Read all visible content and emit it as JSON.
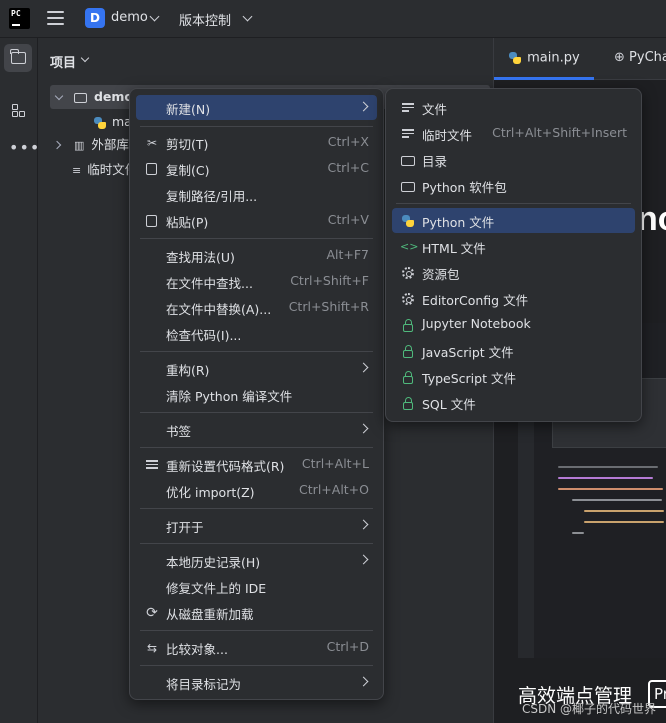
{
  "app": {
    "logo_text": "PC",
    "project_badge": "D",
    "project_name": "demo",
    "vcs_label": "版本控制"
  },
  "project_panel": {
    "title": "项目",
    "tree": [
      {
        "label": "demo",
        "type": "folder"
      },
      {
        "label": "main.py",
        "type": "python-file"
      },
      {
        "label": "外部库",
        "type": "library"
      },
      {
        "label": "临时文件和控制台",
        "type": "scratch"
      }
    ]
  },
  "editor": {
    "tabs": [
      {
        "label": "main.py"
      },
      {
        "label": "PyCharm"
      }
    ],
    "big_text": "no",
    "promo_text": "高效端点管理",
    "promo_box": "Pr",
    "watermark": "CSDN @椰子的代码世界"
  },
  "context_menu": {
    "items": [
      {
        "label": "新建(N)",
        "shortcut": "",
        "submenu": true,
        "icon": ""
      },
      {
        "label": "剪切(T)",
        "shortcut": "Ctrl+X",
        "icon": "scissors-icon"
      },
      {
        "label": "复制(C)",
        "shortcut": "Ctrl+C",
        "icon": "copy-icon"
      },
      {
        "label": "复制路径/引用...",
        "shortcut": "",
        "icon": ""
      },
      {
        "label": "粘贴(P)",
        "shortcut": "Ctrl+V",
        "icon": "paste-icon"
      },
      {
        "label": "查找用法(U)",
        "shortcut": "Alt+F7",
        "icon": ""
      },
      {
        "label": "在文件中查找...",
        "shortcut": "Ctrl+Shift+F",
        "icon": ""
      },
      {
        "label": "在文件中替换(A)...",
        "shortcut": "Ctrl+Shift+R",
        "icon": ""
      },
      {
        "label": "检查代码(I)...",
        "shortcut": "",
        "icon": ""
      },
      {
        "label": "重构(R)",
        "shortcut": "",
        "submenu": true,
        "icon": ""
      },
      {
        "label": "清除 Python 编译文件",
        "shortcut": "",
        "icon": ""
      },
      {
        "label": "书签",
        "shortcut": "",
        "submenu": true,
        "icon": ""
      },
      {
        "label": "重新设置代码格式(R)",
        "shortcut": "Ctrl+Alt+L",
        "icon": "format-icon"
      },
      {
        "label": "优化 import(Z)",
        "shortcut": "Ctrl+Alt+O",
        "icon": ""
      },
      {
        "label": "打开于",
        "shortcut": "",
        "submenu": true,
        "icon": ""
      },
      {
        "label": "本地历史记录(H)",
        "shortcut": "",
        "submenu": true,
        "icon": ""
      },
      {
        "label": "修复文件上的 IDE",
        "shortcut": "",
        "icon": ""
      },
      {
        "label": "从磁盘重新加载",
        "shortcut": "",
        "icon": "reload-icon"
      },
      {
        "label": "比较对象...",
        "shortcut": "Ctrl+D",
        "icon": "compare-icon"
      },
      {
        "label": "将目录标记为",
        "shortcut": "",
        "submenu": true,
        "icon": ""
      }
    ]
  },
  "new_submenu": {
    "items": [
      {
        "label": "文件",
        "shortcut": "",
        "icon": "file-icon"
      },
      {
        "label": "临时文件",
        "shortcut": "Ctrl+Alt+Shift+Insert",
        "icon": "scratch-file-icon"
      },
      {
        "label": "目录",
        "shortcut": "",
        "icon": "folder-icon"
      },
      {
        "label": "Python 软件包",
        "shortcut": "",
        "icon": "package-icon"
      },
      {
        "label": "Python 文件",
        "shortcut": "",
        "icon": "python-icon"
      },
      {
        "label": "HTML 文件",
        "shortcut": "",
        "icon": "html-icon"
      },
      {
        "label": "资源包",
        "shortcut": "",
        "icon": "resource-bundle-icon"
      },
      {
        "label": "EditorConfig 文件",
        "shortcut": "",
        "icon": "editorconfig-icon"
      },
      {
        "label": "Jupyter Notebook",
        "shortcut": "",
        "icon": "jupyter-lock-icon"
      },
      {
        "label": "JavaScript 文件",
        "shortcut": "",
        "icon": "javascript-lock-icon"
      },
      {
        "label": "TypeScript 文件",
        "shortcut": "",
        "icon": "typescript-lock-icon"
      },
      {
        "label": "SQL 文件",
        "shortcut": "",
        "icon": "sql-lock-icon"
      }
    ]
  },
  "colors": {
    "accent": "#3574f0",
    "highlight": "#2e436e",
    "lock_green": "#4fb97c"
  }
}
